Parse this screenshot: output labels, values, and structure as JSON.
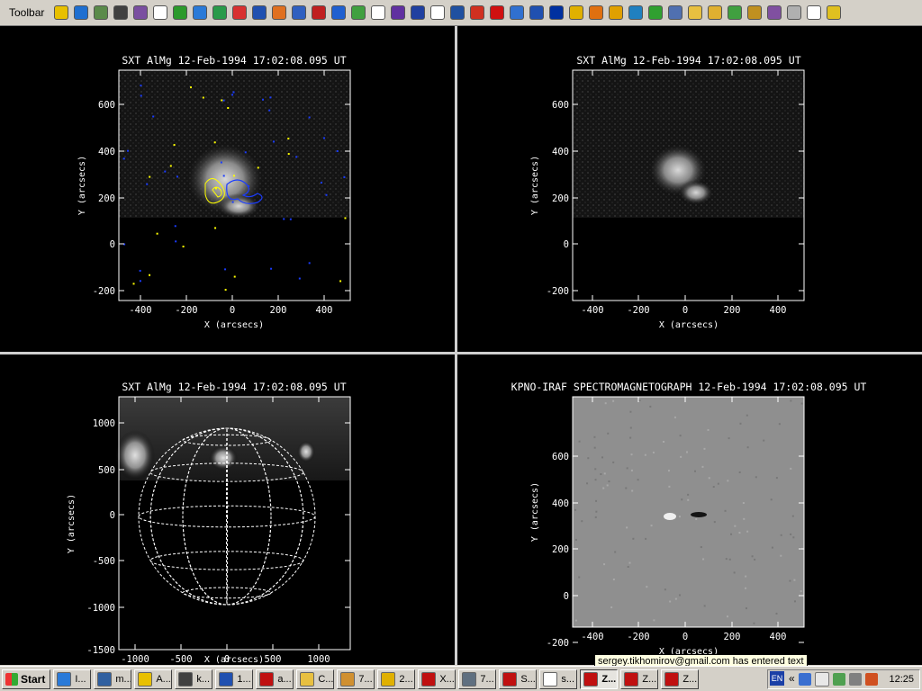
{
  "toolbar": {
    "label": "Toolbar",
    "icons": [
      {
        "name": "a-icon",
        "color": "#e8c000"
      },
      {
        "name": "globe-icon",
        "color": "#1f6fd0"
      },
      {
        "name": "chart-icon",
        "color": "#5a8a4a"
      },
      {
        "name": "terminal-icon",
        "color": "#404040"
      },
      {
        "name": "clock-icon",
        "color": "#7a4fa0"
      },
      {
        "name": "chat-icon",
        "color": "#ffffff"
      },
      {
        "name": "flower-icon",
        "color": "#2c9a2c"
      },
      {
        "name": "ie-icon",
        "color": "#2a7ad8"
      },
      {
        "name": "music-icon",
        "color": "#2a9a4a"
      },
      {
        "name": "lifebuoy-icon",
        "color": "#d83030"
      },
      {
        "name": "word-icon",
        "color": "#2050b0"
      },
      {
        "name": "firefox-icon",
        "color": "#e07020"
      },
      {
        "name": "pin-icon",
        "color": "#3060c0"
      },
      {
        "name": "red-circle-icon",
        "color": "#c02020"
      },
      {
        "name": "blue-ball-icon",
        "color": "#2060d0"
      },
      {
        "name": "recycle-icon",
        "color": "#40a040"
      },
      {
        "name": "calendar-icon",
        "color": "#ffffff"
      },
      {
        "name": "pen-icon",
        "color": "#6030a0"
      },
      {
        "name": "grid-icon",
        "color": "#2040a0"
      },
      {
        "name": "window-icon",
        "color": "#ffffff"
      },
      {
        "name": "network-icon",
        "color": "#2050a0"
      },
      {
        "name": "swirl-icon",
        "color": "#d03020"
      },
      {
        "name": "red-dot-icon",
        "color": "#d01010"
      },
      {
        "name": "photo-icon",
        "color": "#3070d0"
      },
      {
        "name": "doc-icon",
        "color": "#2050b0"
      },
      {
        "name": "close-x-icon",
        "color": "#0030a0"
      },
      {
        "name": "keys-icon",
        "color": "#e0b000"
      },
      {
        "name": "at-icon",
        "color": "#e07010"
      },
      {
        "name": "sun-icon",
        "color": "#e0a000"
      },
      {
        "name": "earth-icon",
        "color": "#2080c0"
      },
      {
        "name": "green-arrow-icon",
        "color": "#30a030"
      },
      {
        "name": "camera-icon",
        "color": "#5070b0"
      },
      {
        "name": "folder-icon",
        "color": "#e8c040"
      },
      {
        "name": "trophy-icon",
        "color": "#e0b030"
      },
      {
        "name": "game-icon",
        "color": "#40a040"
      },
      {
        "name": "clock2-icon",
        "color": "#c09020"
      },
      {
        "name": "book-icon",
        "color": "#8050a0"
      },
      {
        "name": "cd-icon",
        "color": "#b0b0b0"
      },
      {
        "name": "desktop-icon",
        "color": "#ffffff"
      },
      {
        "name": "triangle-icon",
        "color": "#e0c020"
      }
    ]
  },
  "panels": [
    {
      "name": "sxt-overlay-panel",
      "title": "SXT AlMg 12-Feb-1994 17:02:08.095 UT",
      "xlabel": "X (arcsecs)",
      "ylabel": "Y (arcsecs)",
      "xticks": [
        "-400",
        "-200",
        "0",
        "200",
        "400"
      ],
      "yticks": [
        "600",
        "400",
        "200",
        "0",
        "-200"
      ]
    },
    {
      "name": "sxt-image-panel",
      "title": "SXT AlMg 12-Feb-1994 17:02:08.095 UT",
      "xlabel": "X (arcsecs)",
      "ylabel": "Y (arcsecs)",
      "xticks": [
        "-400",
        "-200",
        "0",
        "200",
        "400"
      ],
      "yticks": [
        "600",
        "400",
        "200",
        "0",
        "-200"
      ]
    },
    {
      "name": "sxt-fulldisk-panel",
      "title": "SXT AlMg 12-Feb-1994 17:02:08.095 UT",
      "xlabel": "X (arcsecs)",
      "ylabel": "Y (arcsecs)",
      "xticks": [
        "-1000",
        "-500",
        "0",
        "500",
        "1000"
      ],
      "yticks": [
        "1000",
        "500",
        "0",
        "-500",
        "-1000",
        "-1500"
      ]
    },
    {
      "name": "magnetogram-panel",
      "title": "KPNO-IRAF SPECTROMAGNETOGRAPH 12-Feb-1994 17:02:08.095 UT",
      "xlabel": "X (arcsecs)",
      "ylabel": "Y (arcsecs)",
      "xticks": [
        "-400",
        "-200",
        "0",
        "200",
        "400"
      ],
      "yticks": [
        "600",
        "400",
        "200",
        "0",
        "-200"
      ]
    }
  ],
  "tooltip": "sergey.tikhomirov@gmail.com has entered text",
  "taskbar": {
    "start_label": "Start",
    "tasks": [
      {
        "label": "I...",
        "icon": "ie-icon",
        "color": "#2a7ad8"
      },
      {
        "label": "m...",
        "icon": "mail-icon",
        "color": "#3060a0"
      },
      {
        "label": "A...",
        "icon": "a-icon",
        "color": "#e8c000"
      },
      {
        "label": "k...",
        "icon": "grid-icon",
        "color": "#404040"
      },
      {
        "label": "1...",
        "icon": "doc-icon",
        "color": "#2050b0"
      },
      {
        "label": "a...",
        "icon": "x-icon",
        "color": "#c01010"
      },
      {
        "label": "C...",
        "icon": "folder-icon",
        "color": "#e8c040"
      },
      {
        "label": "7...",
        "icon": "brush-icon",
        "color": "#d09030"
      },
      {
        "label": "2...",
        "icon": "keys-icon",
        "color": "#e0b000"
      },
      {
        "label": "X...",
        "icon": "x-icon",
        "color": "#c01010"
      },
      {
        "label": "7...",
        "icon": "photo-icon",
        "color": "#607080"
      },
      {
        "label": "S...",
        "icon": "x-icon",
        "color": "#c01010"
      },
      {
        "label": "s...",
        "icon": "chat-icon",
        "color": "#ffffff"
      },
      {
        "label": "Z...",
        "icon": "x-icon",
        "color": "#c01010",
        "active": true
      },
      {
        "label": "Z...",
        "icon": "x-icon",
        "color": "#c01010"
      },
      {
        "label": "Z...",
        "icon": "x-icon",
        "color": "#c01010"
      }
    ],
    "lang": "EN",
    "clock": "12:25"
  }
}
